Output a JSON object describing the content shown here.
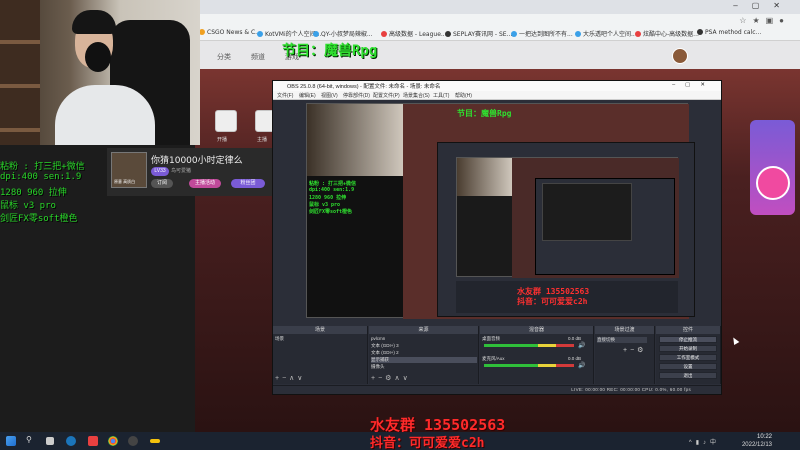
{
  "browser": {
    "bookmarks": [
      {
        "label": "CSGO News & C...",
        "color": "#f0a020"
      },
      {
        "label": "KotVMi的个人空间...",
        "color": "#3aa0e8"
      },
      {
        "label": "QY-小叔梦局辣椒...",
        "color": "#3aa0e8"
      },
      {
        "label": "高级数据 - League...",
        "color": "#e84040"
      },
      {
        "label": "SEPLAY赛讯网 - SE...",
        "color": "#333333"
      },
      {
        "label": "一把达到图所不有...",
        "color": "#3aa0e8"
      },
      {
        "label": "大乐透吧个人空间...",
        "color": "#3aa0e8"
      },
      {
        "label": "炫酷中心-高级数据...",
        "color": "#e84040"
      },
      {
        "label": "PSA method calc...",
        "color": "#333333"
      }
    ],
    "nav": [
      "分类",
      "频道",
      "游戏"
    ],
    "page_sidebar": [
      "开播",
      "主播"
    ]
  },
  "overlay": {
    "program_label": "节目：魔兽Rpg",
    "qq_group": "水友群 135502563",
    "douyin": "抖音：可可爱爱c2h",
    "info_lines": [
      "粘粉 : 打三把+微信",
      "dpi:400 sen:1.9",
      "1280 960 拉伸",
      "鼠标 v3 pro",
      "剑匠FX零soft橙色"
    ]
  },
  "streamer_card": {
    "title": "你猜10000小时定律么",
    "badge": "LV33",
    "subtitle": "鸟可爱猪",
    "follow": "订阅",
    "pills": [
      "主播活动",
      "粉丝团"
    ],
    "avatar_caption": "原意 高质白"
  },
  "obs": {
    "title": "OBS 25.0.8 (64-bit, windows) - 配置文件: 未命名 - 场景: 未命名",
    "menu": [
      "文件(F)",
      "编辑(E)",
      "视图(V)",
      "停靠部件(D)",
      "配置文件(P)",
      "场景集合(S)",
      "工具(T)",
      "帮助(H)"
    ],
    "docks": {
      "scenes": {
        "header": "场景",
        "items": [
          "场景"
        ]
      },
      "sources": {
        "header": "来源",
        "items": [
          "pvlcmn",
          "文本 (GDI+) 3",
          "文本 (GDI+) 2",
          "显示捕获",
          "摄像头"
        ]
      },
      "mixer": {
        "header": "混音器",
        "items": [
          "桌面音频",
          "麦克风/Aux"
        ],
        "db": [
          "0.0 dB",
          "0.0 dB"
        ]
      },
      "transitions": {
        "header": "场景过渡",
        "type": "直接切换"
      },
      "controls": {
        "header": "控件",
        "buttons": [
          "停止推流",
          "开始录制",
          "工作室模式",
          "设置",
          "退出"
        ]
      }
    },
    "status": "LIVE: 00:00:00   REC: 00:00:00   CPU: 0.0%, 60.00 fps"
  },
  "nested_overlay": {
    "qq_group": "水友群 135502563",
    "douyin": "抖音：可可爱爱c2h",
    "program": "节目：魔兽Rpg"
  },
  "taskbar": {
    "time": "10:22",
    "date": "2022/12/13"
  }
}
